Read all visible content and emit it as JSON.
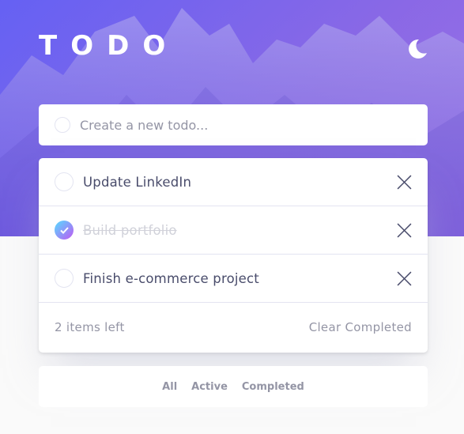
{
  "app": {
    "title": "TODO"
  },
  "new_todo": {
    "placeholder": "Create a new todo...",
    "value": ""
  },
  "todos": [
    {
      "label": "Update LinkedIn",
      "completed": false
    },
    {
      "label": "Build portfolio",
      "completed": true
    },
    {
      "label": "Finish e-commerce project",
      "completed": false
    }
  ],
  "footer": {
    "items_left": "2 items left",
    "clear_label": "Clear Completed"
  },
  "filters": {
    "all": "All",
    "active": "Active",
    "completed": "Completed"
  },
  "colors": {
    "accent_start": "#55ddff",
    "accent_end": "#c058f3",
    "text": "#494c6b",
    "muted": "#9495a5",
    "completed_text": "#d1d2da"
  },
  "icons": {
    "theme_toggle": "moon-icon",
    "remove": "cross-icon",
    "check": "check-icon"
  }
}
